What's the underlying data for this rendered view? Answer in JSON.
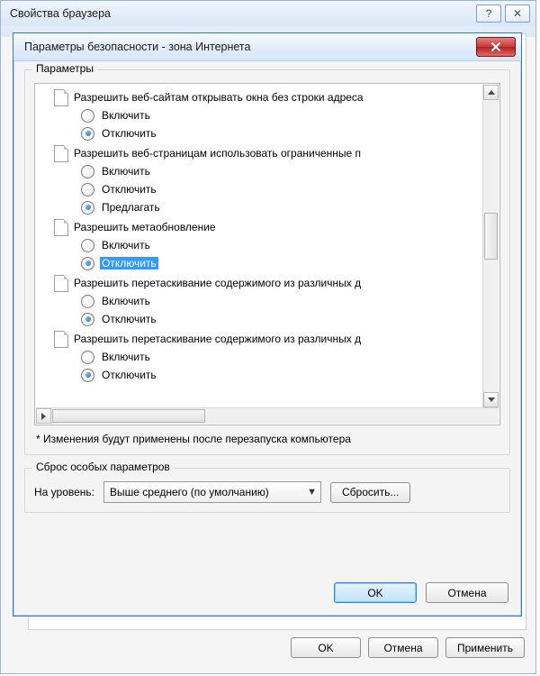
{
  "outer": {
    "title": "Свойства браузера",
    "help_icon": "?",
    "close_icon": "✕",
    "footer": {
      "ok": "OK",
      "cancel": "Отмена",
      "apply": "Применить"
    }
  },
  "dialog": {
    "title": "Параметры безопасности - зона Интернета",
    "params_legend": "Параметры",
    "note": "* Изменения будут применены после перезапуска компьютера",
    "groups": [
      {
        "title": "Разрешить веб-сайтам открывать окна без строки адреса",
        "options": [
          {
            "label": "Включить",
            "selected": false,
            "highlight": false
          },
          {
            "label": "Отключить",
            "selected": true,
            "highlight": false
          }
        ]
      },
      {
        "title": "Разрешить веб-страницам использовать ограниченные п",
        "options": [
          {
            "label": "Включить",
            "selected": false,
            "highlight": false
          },
          {
            "label": "Отключить",
            "selected": false,
            "highlight": false
          },
          {
            "label": "Предлагать",
            "selected": true,
            "highlight": false
          }
        ]
      },
      {
        "title": "Разрешить метаобновление",
        "options": [
          {
            "label": "Включить",
            "selected": false,
            "highlight": false
          },
          {
            "label": "Отключить",
            "selected": true,
            "highlight": true
          }
        ]
      },
      {
        "title": "Разрешить перетаскивание содержимого из различных д",
        "options": [
          {
            "label": "Включить",
            "selected": false,
            "highlight": false
          },
          {
            "label": "Отключить",
            "selected": true,
            "highlight": false
          }
        ]
      },
      {
        "title": "Разрешить перетаскивание содержимого из различных д",
        "options": [
          {
            "label": "Включить",
            "selected": false,
            "highlight": false
          },
          {
            "label": "Отключить",
            "selected": true,
            "highlight": false
          }
        ]
      }
    ],
    "reset": {
      "legend": "Сброс особых параметров",
      "label": "На уровень:",
      "value": "Выше среднего (по умолчанию)",
      "button": "Сбросить..."
    },
    "footer": {
      "ok": "OK",
      "cancel": "Отмена"
    }
  }
}
